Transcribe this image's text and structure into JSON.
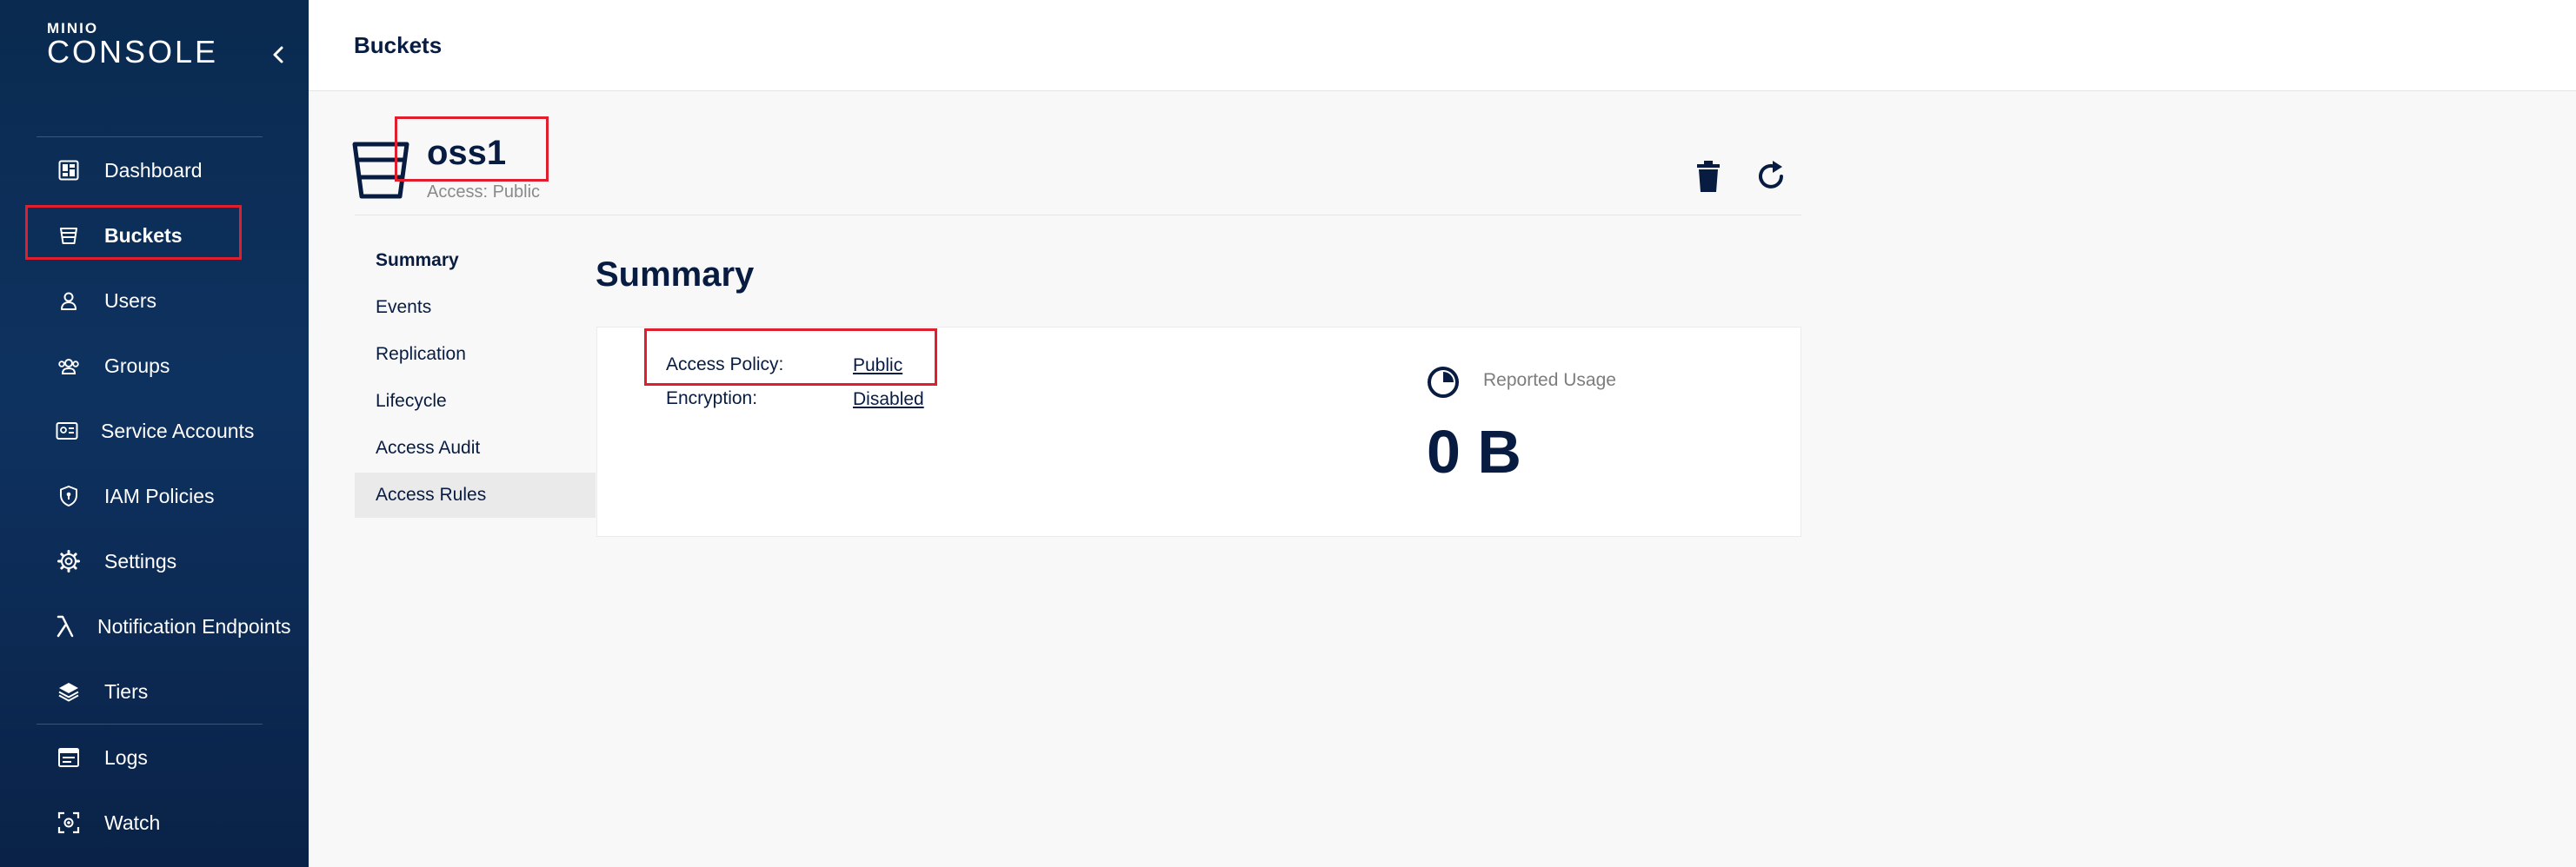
{
  "logo": {
    "small": "MINIO",
    "big": "CONSOLE"
  },
  "sidebar": {
    "items": [
      {
        "label": "Dashboard"
      },
      {
        "label": "Buckets"
      },
      {
        "label": "Users"
      },
      {
        "label": "Groups"
      },
      {
        "label": "Service Accounts"
      },
      {
        "label": "IAM Policies"
      },
      {
        "label": "Settings"
      },
      {
        "label": "Notification Endpoints"
      },
      {
        "label": "Tiers"
      },
      {
        "label": "Logs"
      },
      {
        "label": "Watch"
      }
    ],
    "active": "Buckets"
  },
  "header": {
    "title": "Buckets"
  },
  "bucket": {
    "name": "oss1",
    "access": "Access: Public"
  },
  "subnav": {
    "items": [
      {
        "label": "Summary"
      },
      {
        "label": "Events"
      },
      {
        "label": "Replication"
      },
      {
        "label": "Lifecycle"
      },
      {
        "label": "Access Audit"
      },
      {
        "label": "Access Rules"
      }
    ],
    "active": "Summary",
    "selected": "Access Rules"
  },
  "summary": {
    "title": "Summary",
    "access_policy_label": "Access Policy:",
    "access_policy_value": "Public",
    "encryption_label": "Encryption:",
    "encryption_value": "Disabled",
    "reported_usage_label": "Reported Usage",
    "reported_usage_value": "0 B"
  },
  "colors": {
    "sidebar": "#0e3260",
    "highlight": "#e01e2d",
    "text": "#081c42"
  }
}
